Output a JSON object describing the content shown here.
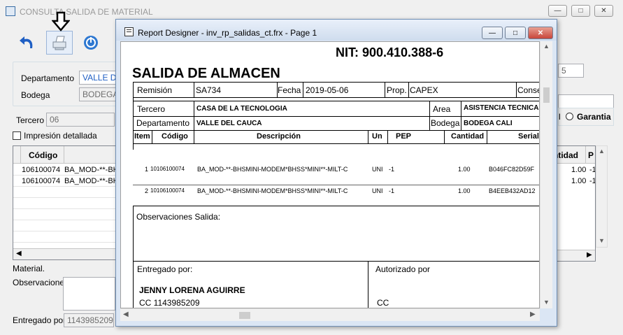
{
  "background_window": {
    "title": "CONSULTA SALIDA DE MATERIAL",
    "labels": {
      "departamento": "Departamento",
      "bodega": "Bodega",
      "tercero": "Tercero",
      "impresion_detallada": "Impresión detallada",
      "codigo_header": "Código",
      "cantidad_header": "ntidad",
      "p_header": "P",
      "material": "Material.",
      "observaciones": "Observaciones",
      "entregado_por": "Entregado por:",
      "garantia": "Garantia"
    },
    "values": {
      "departamento": "VALLE DE",
      "bodega": "BODEGA",
      "tercero": "06",
      "field_5": "5",
      "entregado_por": "1143985209",
      "impresion_detallada_checked": false,
      "garantia_selected": false
    },
    "grid_rows": [
      {
        "codigo": "106100074",
        "descripcion": "BA_MOD-**-BH",
        "cantidad": "1.00",
        "p": "-1"
      },
      {
        "codigo": "106100074",
        "descripcion": "BA_MOD-**-BH",
        "cantidad": "1.00",
        "p": "-1"
      }
    ],
    "icons": [
      "undo-icon",
      "print-icon",
      "power-icon"
    ]
  },
  "report_designer": {
    "title": "Report Designer - inv_rp_salidas_ct.frx - Page 1",
    "report": {
      "nit": "NIT: 900.410.388-6",
      "heading": "SALIDA DE ALMACEN",
      "remision_label": "Remisión",
      "remision_value": "SA734",
      "fecha_label": "Fecha",
      "fecha_value": "2019-05-06",
      "prop_label": "Prop.",
      "prop_value": "CAPEX",
      "conse_label": "Conse",
      "tercero_label": "Tercero",
      "tercero_value": "CASA DE LA TECNOLOGIA",
      "area_label": "Area",
      "area_value": "ASISTENCIA TECNICA",
      "departamento_label": "Departamento",
      "departamento_value": "VALLE DEL CAUCA",
      "bodega_label": "Bodega",
      "bodega_value": "BODEGA CALI",
      "columns": {
        "item": "Item",
        "codigo": "Código",
        "descripcion": "Descripción",
        "un": "Un",
        "pep": "PEP",
        "cantidad": "Cantidad",
        "serial": "Serial"
      },
      "items": [
        {
          "item": "1",
          "codigo": "10106100074",
          "descripcion": "BA_MOD-**-BHSMINI-MODEM*BHSS*MINI**-MILT-C",
          "un": "UNI",
          "pep": "-1",
          "cantidad": "1.00",
          "serial": "B046FC82D59F"
        },
        {
          "item": "2",
          "codigo": "10106100074",
          "descripcion": "BA_MOD-**-BHSMINI-MODEM*BHSS*MINI**-MILT-C",
          "un": "UNI",
          "pep": "-1",
          "cantidad": "1.00",
          "serial": "B4EEB432AD12"
        }
      ],
      "observaciones_label": "Observaciones Salida:",
      "entregado_label": "Entregado por:",
      "entregado_name": "JENNY LORENA AGUIRRE",
      "entregado_cc": "CC  1143985209",
      "autorizado_label": "Autorizado por",
      "autorizado_cc": "CC"
    }
  },
  "colors": {
    "accent_blue": "#1f5fc4",
    "title_inactive": "#9a9a9a",
    "close_red": "#c8453a"
  }
}
